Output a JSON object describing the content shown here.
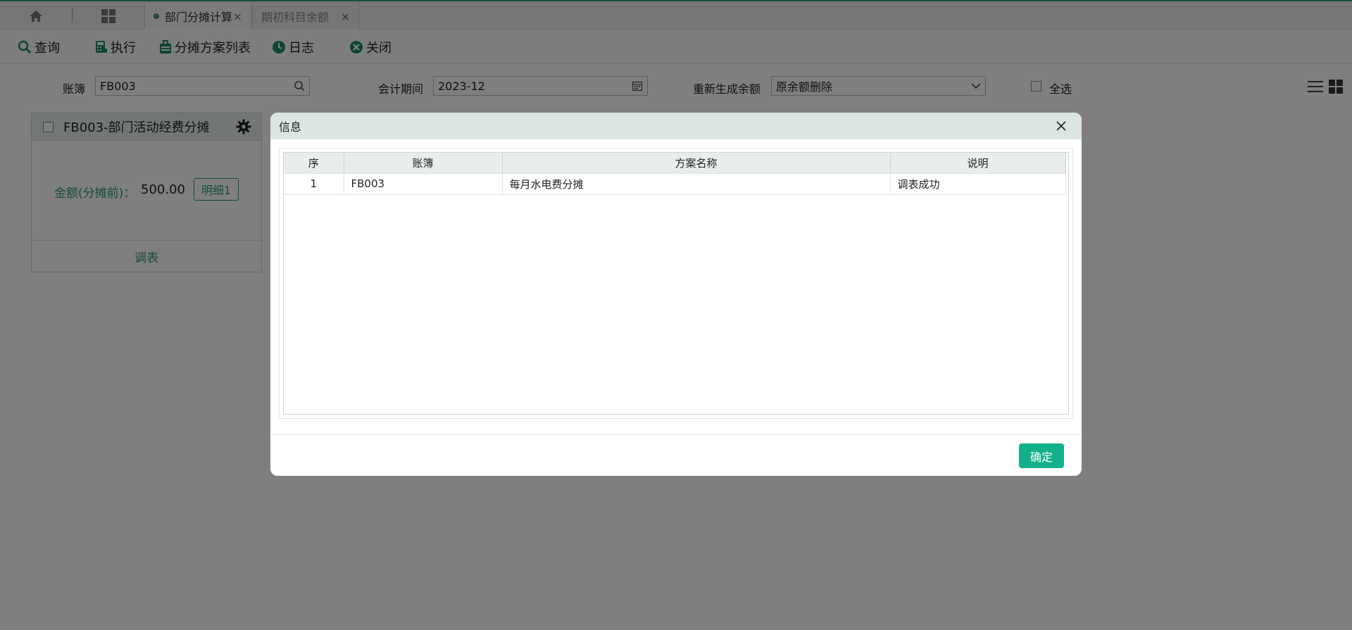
{
  "tabs": [
    {
      "label": "部门分摊计算",
      "active": true
    },
    {
      "label": "期初科目余额",
      "active": false
    }
  ],
  "toolbar": {
    "query": "查询",
    "execute": "执行",
    "scheme_list": "分摊方案列表",
    "log": "日志",
    "close": "关闭"
  },
  "filters": {
    "ledger_label": "账簿",
    "ledger_value": "FB003",
    "period_label": "会计期间",
    "period_value": "2023-12",
    "regen_label": "重新生成余额",
    "regen_value": "原余额删除",
    "select_all_label": "全选"
  },
  "card": {
    "title": "FB003-部门活动经费分摊",
    "amount_label": "金额(分摊前)：",
    "amount_value": "500.00",
    "detail_button": "明细1",
    "footer_link": "调表"
  },
  "dialog": {
    "title": "信息",
    "columns": [
      "序",
      "账簿",
      "方案名称",
      "说明"
    ],
    "rows": [
      [
        "1",
        "FB003",
        "每月水电费分摊",
        "调表成功"
      ]
    ],
    "ok_button": "确定"
  },
  "colors": {
    "accent": "#2a9d74",
    "ok_button": "#12b18c"
  }
}
